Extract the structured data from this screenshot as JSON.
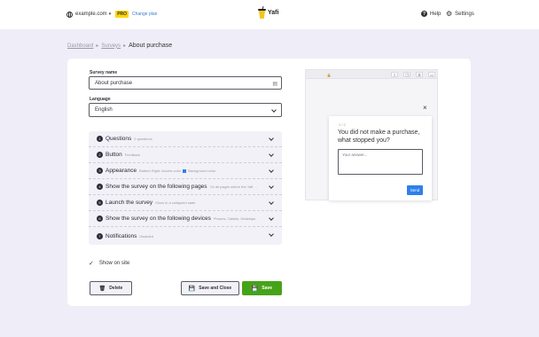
{
  "header": {
    "site": "example.com",
    "plan_badge": "PRO",
    "change_plan": "Change plan",
    "logo_text": "Yafi",
    "help": "Help",
    "settings": "Settings"
  },
  "breadcrumb": {
    "items": [
      "Dashboard",
      "Surveys"
    ],
    "current": "About purchase"
  },
  "form": {
    "survey_name_label": "Survey name",
    "survey_name_value": "About purchase",
    "language_label": "Language",
    "language_value": "English"
  },
  "sections": [
    {
      "num": "1",
      "title": "Questions",
      "sub": "2 questions"
    },
    {
      "num": "2",
      "title": "Button",
      "sub": "Feedback"
    },
    {
      "num": "3",
      "title": "Appearance",
      "sub": "Bottom Right, Accent color",
      "sub2": "Background color"
    },
    {
      "num": "4",
      "title": "Show the survey on the following pages",
      "sub": "On all pages where the Yafi ..."
    },
    {
      "num": "5",
      "title": "Launch the survey",
      "sub": "Show in a collapsed state"
    },
    {
      "num": "6",
      "title": "Show the survey on the following devices",
      "sub": "Phones, Tablets, Desktops"
    },
    {
      "num": "7",
      "title": "Notifications",
      "sub": "Disabled"
    }
  ],
  "show_on_site": "Show on site",
  "buttons": {
    "delete": "Delete",
    "save_close": "Save and Close",
    "save": "Save"
  },
  "preview": {
    "counter": "1 / 2",
    "question": "You did not make a purchase, what stopped you?",
    "answer_placeholder": "Your answer...",
    "send": "Send"
  },
  "colors": {
    "background": "#efedf7",
    "accent_green": "#46a318",
    "accent_blue": "#2f80ed",
    "pro_badge": "#ffd500"
  }
}
